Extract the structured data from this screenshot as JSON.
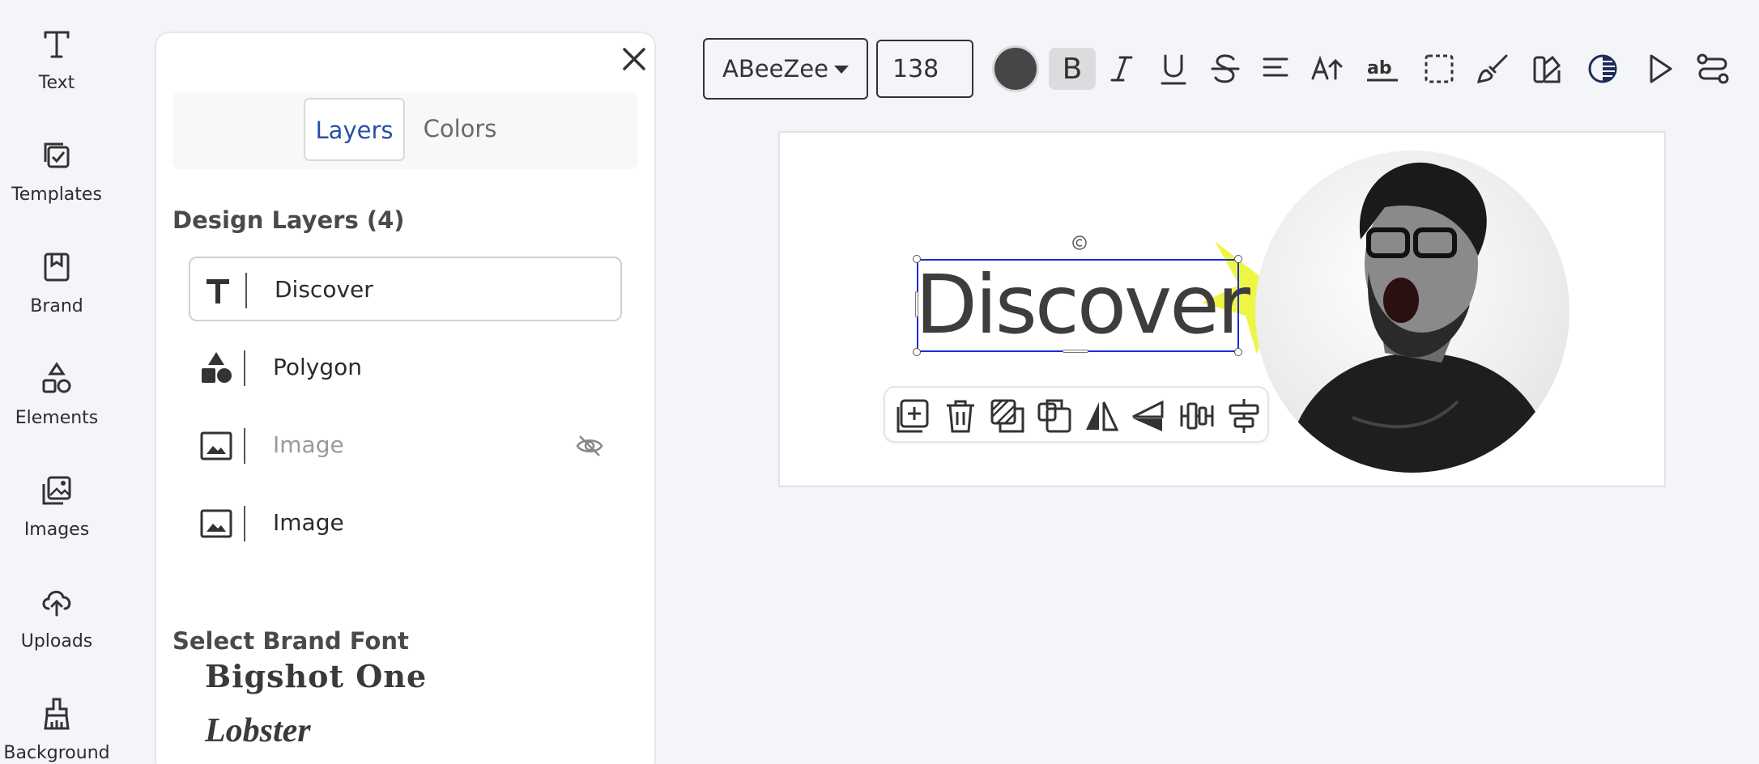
{
  "sidebar": {
    "items": [
      {
        "label": "Text",
        "icon": "text-icon"
      },
      {
        "label": "Templates",
        "icon": "templates-icon"
      },
      {
        "label": "Brand",
        "icon": "brand-icon"
      },
      {
        "label": "Elements",
        "icon": "elements-icon"
      },
      {
        "label": "Images",
        "icon": "images-icon"
      },
      {
        "label": "Uploads",
        "icon": "upload-icon"
      },
      {
        "label": "Background",
        "icon": "background-icon"
      }
    ]
  },
  "panel": {
    "tabs": [
      {
        "label": "Layers",
        "active": true
      },
      {
        "label": "Colors",
        "active": false
      }
    ],
    "layers_title": "Design Layers (4)",
    "layers": [
      {
        "name": "Discover",
        "type": "text",
        "active": true,
        "hidden": false
      },
      {
        "name": "Polygon",
        "type": "shape",
        "active": false,
        "hidden": false
      },
      {
        "name": "Image",
        "type": "image",
        "active": false,
        "hidden": true
      },
      {
        "name": "Image",
        "type": "image",
        "active": false,
        "hidden": false
      }
    ],
    "brand_font_title": "Select Brand Font",
    "brand_fonts": [
      "Bigshot One",
      "Lobster"
    ]
  },
  "toolbar": {
    "font_family": "ABeeZee",
    "font_size": "138",
    "text_color": "#464646",
    "bold_label": "B",
    "bold_active": true
  },
  "canvas": {
    "text": "Discover",
    "star_color": "#eef545",
    "selection_color": "#1a2dd8"
  }
}
